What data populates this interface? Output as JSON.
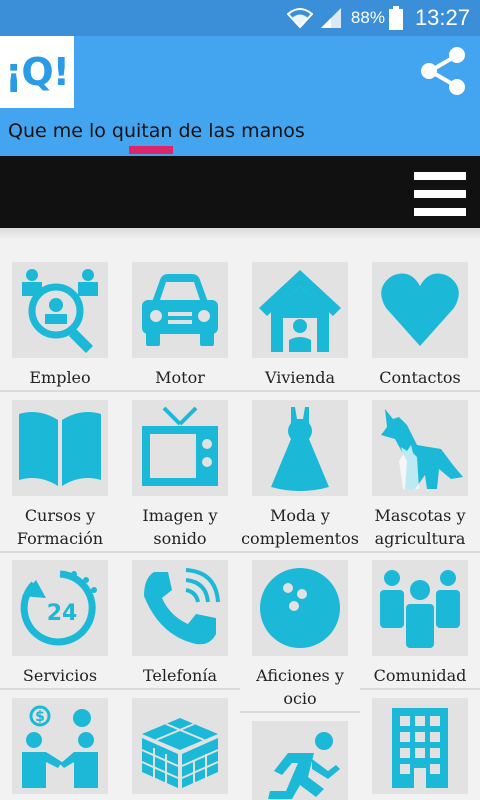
{
  "status_bar": {
    "battery": "88%",
    "time": "13:27",
    "icons": [
      "wifi-icon",
      "signal-icon",
      "battery-icon"
    ]
  },
  "app_bar": {
    "logo": "¡Q!",
    "tagline": "Que me lo quitan de las manos",
    "share_icon": "share-icon",
    "color": "#43a5f0",
    "accent": "#e0246a"
  },
  "nav_bar": {
    "menu_icon": "hamburger-menu-icon"
  },
  "icon_color": "#1cb8d8",
  "categories": [
    {
      "label": "Empleo",
      "icon": "employment-icon"
    },
    {
      "label": "Motor",
      "icon": "car-icon"
    },
    {
      "label": "Vivienda",
      "icon": "house-icon"
    },
    {
      "label": "Contactos",
      "icon": "heart-icon"
    },
    {
      "label": "Cursos y Formación",
      "icon": "book-icon"
    },
    {
      "label": "Imagen y sonido",
      "icon": "tv-icon"
    },
    {
      "label": "Moda y complementos",
      "icon": "dress-icon"
    },
    {
      "label": "Mascotas y agricultura",
      "icon": "pets-icon"
    },
    {
      "label": "Servicios",
      "icon": "24h-service-icon"
    },
    {
      "label": "Telefonía",
      "icon": "phone-icon"
    },
    {
      "label": "Aficiones y ocio",
      "icon": "bowling-ball-icon"
    },
    {
      "label": "Comunidad",
      "icon": "community-icon"
    },
    {
      "label": "",
      "icon": "business-deal-icon"
    },
    {
      "label": "",
      "icon": "rubik-cube-icon"
    },
    {
      "label": "",
      "icon": "running-man-icon"
    },
    {
      "label": "",
      "icon": "building-icon"
    }
  ]
}
